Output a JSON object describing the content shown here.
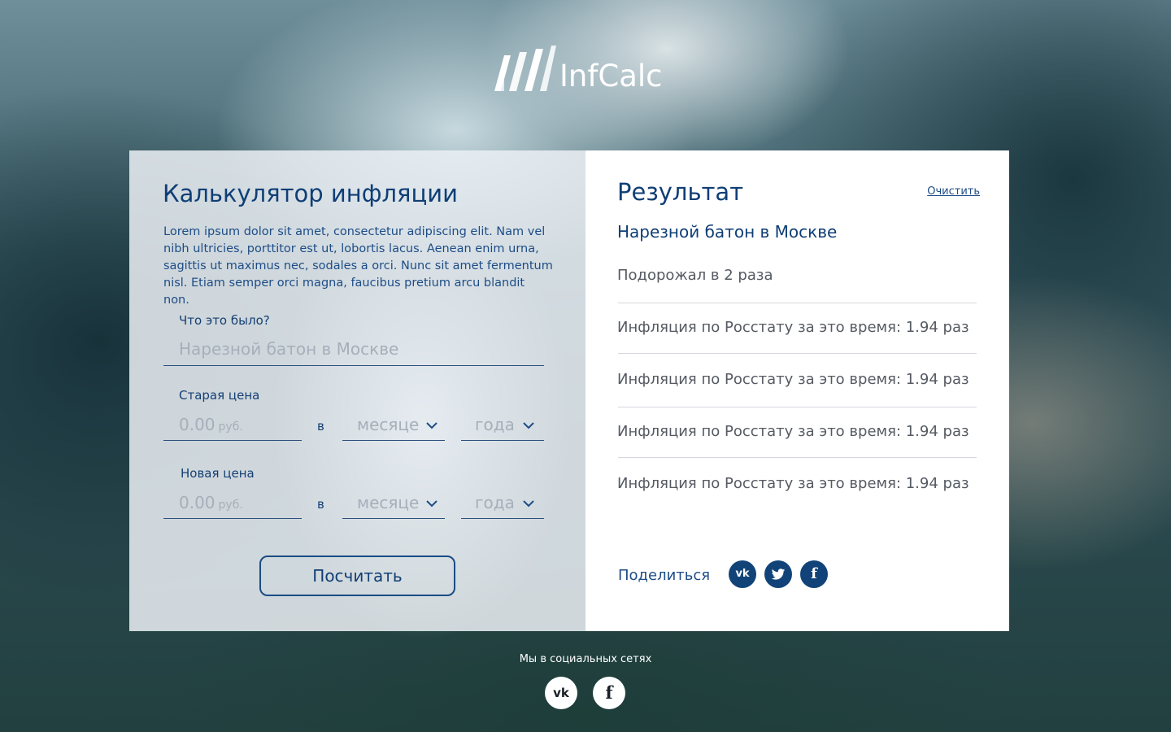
{
  "brand": {
    "name": "InfCalc",
    "text_color": "#ffffff"
  },
  "calculator": {
    "title": "Калькулятор инфляции",
    "description": "Lorem ipsum dolor sit amet, consectetur adipiscing elit. Nam vel nibh ultricies, porttitor est ut, lobortis lacus. Aenean enim urna, sagittis ut maximus nec, sodales a orci. Nunc sit amet fermentum nisl. Etiam semper orci magna, faucibus pretium arcu blandit non.",
    "what_label": "Что это было?",
    "what_placeholder": "Нарезной батон в Москве",
    "old_price": {
      "label": "Старая цена",
      "price_placeholder": "0.00",
      "unit": "руб.",
      "separator": "в",
      "month_placeholder": "месяце",
      "year_placeholder": "года"
    },
    "new_price": {
      "label": "Новая цена",
      "price_placeholder": "0.00",
      "unit": "руб.",
      "separator": "в",
      "month_placeholder": "месяце",
      "year_placeholder": "года"
    },
    "submit_label": "Посчитать",
    "accent_color": "#0f3e75"
  },
  "result": {
    "title": "Результат",
    "clear_label": "Очистить",
    "product": "Нарезной батон в Москве",
    "rows": [
      "Подорожал в 2 раза",
      "Инфляция по Росстату за это время: 1.94 раз",
      "Инфляция по Росстату за это время: 1.94 раз",
      "Инфляция по Росстату за это время: 1.94 раз",
      "Инфляция по Росстату за это время: 1.94 раз"
    ],
    "share_label": "Поделиться",
    "share_icons": [
      "vk-icon",
      "twitter-icon",
      "facebook-icon"
    ],
    "share_color": "#124378"
  },
  "footer": {
    "label": "Мы в социальных сетях",
    "icons": [
      "vk-icon",
      "facebook-icon"
    ]
  }
}
